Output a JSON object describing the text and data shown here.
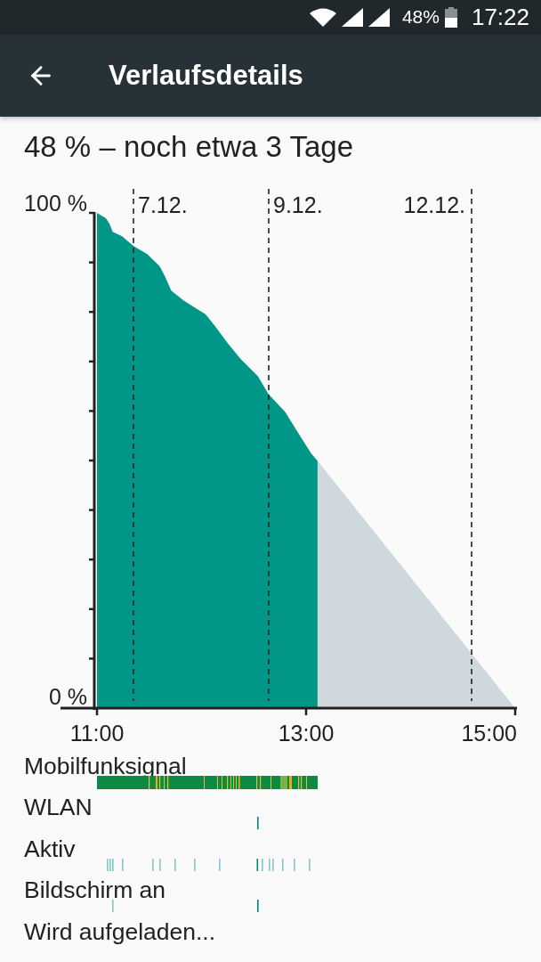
{
  "status_bar": {
    "battery": "48%",
    "time": "17:22"
  },
  "app_bar": {
    "title": "Verlaufsdetails"
  },
  "summary": "48 % – noch etwa 3 Tage",
  "chart": {
    "date_markers": [
      {
        "label": "7.12."
      },
      {
        "label": "9.12."
      },
      {
        "label": "12.12."
      }
    ],
    "chart_data": {
      "type": "area",
      "x": [
        11.0,
        11.085,
        11.12,
        11.15,
        11.24,
        11.35,
        11.48,
        11.6,
        11.65,
        11.71,
        11.83,
        12.04,
        12.13,
        12.25,
        12.37,
        12.54,
        12.64,
        12.8,
        12.92,
        13.05,
        13.11,
        15.0
      ],
      "series": [
        {
          "color": "#009688",
          "values": [
            100,
            98.9,
            97.8,
            96.2,
            95.3,
            93.3,
            91.7,
            89.2,
            87.2,
            84.3,
            82.3,
            79.5,
            77.1,
            73.7,
            70.6,
            67.0,
            63.4,
            59.8,
            55.7,
            51.4,
            49.9,
            null
          ]
        },
        {
          "color": "#cfd8dc",
          "values": [
            null,
            null,
            null,
            null,
            null,
            null,
            null,
            null,
            null,
            null,
            null,
            null,
            null,
            null,
            null,
            null,
            null,
            null,
            null,
            null,
            49.9,
            0
          ]
        }
      ],
      "xlim": [
        11,
        15
      ],
      "ylim": [
        0,
        100
      ],
      "xticks": [
        {
          "value": 11,
          "label": "11:00"
        },
        {
          "value": 13,
          "label": "13:00"
        },
        {
          "value": 15,
          "label": "15:00"
        }
      ],
      "yticks": [
        {
          "value": 0,
          "label": "0 %"
        },
        {
          "value": 100,
          "label": "100 %"
        }
      ]
    }
  },
  "activity_rows": [
    {
      "label": "Mobilfunksignal",
      "kind": "signal"
    },
    {
      "label": "WLAN",
      "kind": "wifi"
    },
    {
      "label": "Aktiv",
      "kind": "awake"
    },
    {
      "label": "Bildschirm an",
      "kind": "screen"
    },
    {
      "label": "Wird aufgeladen...",
      "kind": "charging"
    }
  ]
}
